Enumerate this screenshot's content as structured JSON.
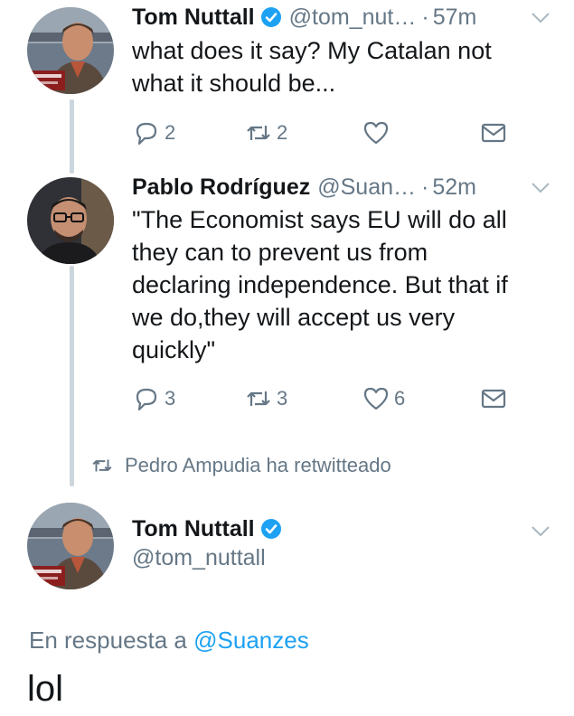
{
  "tweets": [
    {
      "name": "Tom Nuttall",
      "handle": "@tom_nut…",
      "dot": "·",
      "time": "57m",
      "text_lines": [
        "what does it say? My Catalan not",
        "what it should be..."
      ],
      "replies": "2",
      "retweets": "2",
      "likes": ""
    },
    {
      "name": "Pablo Rodríguez",
      "handle": "@Suan…",
      "dot": "·",
      "time": "52m",
      "text_lines": [
        "\"The Economist says EU will do all",
        "they can to prevent us from",
        "declaring independence. But that if",
        "we do,they will accept us very",
        "quickly\""
      ],
      "replies": "3",
      "retweets": "3",
      "likes": "6"
    }
  ],
  "retweet_note": "Pedro Ampudia ha retwitteado",
  "focused": {
    "name": "Tom Nuttall",
    "handle": "@tom_nuttall",
    "reply_prefix": "En respuesta a",
    "reply_handle": "@Suanzes",
    "text": "lol"
  },
  "colors": {
    "text": "#14171a",
    "muted": "#657786",
    "accent": "#1da1f2",
    "thread_line": "#ccd6dd"
  },
  "icons": [
    "verified-icon",
    "chevron-down-icon",
    "reply-icon",
    "retweet-icon",
    "like-icon",
    "dm-icon"
  ]
}
